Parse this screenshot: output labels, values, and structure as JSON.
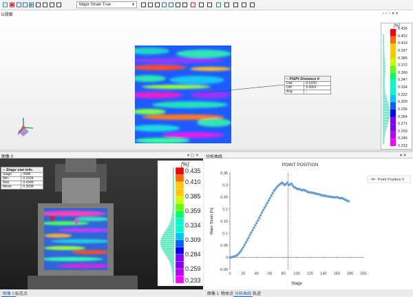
{
  "toolbar": {
    "dropdown_value": "Major Strain True",
    "icons": [
      "record-icon",
      "stop-icon",
      "prev-frame-icon",
      "next-frame-icon",
      "play-icon",
      "save-icon",
      "export-icon",
      "grid-icon",
      "layout-icon",
      "undo-icon",
      "redo-icon",
      "rotate-icon",
      "pan-icon",
      "fit-icon",
      "zoom-icon",
      "shape-icon",
      "delete-icon",
      "measure-icon",
      "display-icon",
      "sync-icon",
      "view-icon",
      "point-icon",
      "scale-icon",
      "compare-icon"
    ]
  },
  "view3d": {
    "title": "D视图",
    "controls": "‹ ›  ♂  ▾ ✕",
    "colorbar": {
      "unit": "[%]",
      "ticks": [
        "0.435",
        "0.422",
        "0.410",
        "0.397",
        "0.385",
        "0.372",
        "0.360",
        "0.347",
        "0.334",
        "0.322",
        "0.309",
        "0.296",
        "0.284",
        "0.271",
        "0.259",
        "0.246",
        "0.233"
      ]
    },
    "p2p": {
      "title": "Pt2Pt Distance 0",
      "rows": [
        [
          "Dist.",
          "0.0330"
        ],
        [
          "Def.",
          "0.0001"
        ],
        [
          "Avg.",
          "-"
        ]
      ]
    }
  },
  "camera": {
    "title": "图像 0",
    "header_controls": "▾ ▢ ✕",
    "stat": {
      "title": "Stage stat info.",
      "rows": [
        [
          "Stage",
          "0086"
        ],
        [
          "Min.",
          "0.2334"
        ],
        [
          "Max.",
          "0.4349"
        ],
        [
          "Mean.",
          "0.3038"
        ]
      ]
    },
    "colorbar": {
      "unit": "[%]",
      "ticks": [
        "0.435",
        "0.410",
        "0.385",
        "0.359",
        "0.334",
        "0.309",
        "0.284",
        "0.259",
        "0.233"
      ]
    }
  },
  "chart_pane": {
    "title": "分析曲线",
    "header_controls": "▾ ✕"
  },
  "chart_data": {
    "type": "line",
    "title": "POINT POSITION",
    "xlabel": "Stage",
    "ylabel": "Major Strain [%]",
    "xlim": [
      0,
      200
    ],
    "ylim": [
      -0.05,
      0.35
    ],
    "xticks": [
      "0",
      "20",
      "40",
      "60",
      "80",
      "100",
      "120",
      "140",
      "160",
      "180",
      "200"
    ],
    "yticks": [
      "-0.05",
      "0",
      "0.05",
      "0.1",
      "0.15",
      "0.2",
      "0.25",
      "0.3",
      "0.35"
    ],
    "marker_x": 87,
    "legend": "right",
    "series": [
      {
        "name": "Point Position 0",
        "x": [
          0,
          2,
          4,
          6,
          8,
          10,
          12,
          14,
          16,
          18,
          20,
          22,
          24,
          26,
          28,
          30,
          32,
          34,
          36,
          38,
          40,
          42,
          44,
          46,
          48,
          50,
          52,
          54,
          56,
          58,
          60,
          62,
          64,
          66,
          68,
          70,
          72,
          74,
          76,
          78,
          80,
          82,
          84,
          86,
          88,
          90,
          92,
          94,
          96,
          98,
          100,
          102,
          104,
          106,
          108,
          110,
          112,
          114,
          116,
          118,
          120,
          122,
          124,
          126,
          128,
          130,
          132,
          134,
          136,
          138,
          140,
          142,
          144,
          146,
          148,
          150,
          152,
          154,
          156,
          158,
          160,
          162,
          164,
          166,
          168,
          170,
          172,
          174,
          176,
          178
        ],
        "y": [
          0,
          0,
          0.002,
          0.003,
          0.005,
          0.008,
          0.012,
          0.018,
          0.025,
          0.033,
          0.042,
          0.052,
          0.062,
          0.072,
          0.082,
          0.093,
          0.103,
          0.113,
          0.123,
          0.133,
          0.143,
          0.153,
          0.164,
          0.175,
          0.186,
          0.196,
          0.206,
          0.216,
          0.226,
          0.236,
          0.246,
          0.256,
          0.266,
          0.276,
          0.283,
          0.29,
          0.296,
          0.301,
          0.305,
          0.31,
          0.305,
          0.3,
          0.304,
          0.31,
          0.3,
          0.302,
          0.306,
          0.298,
          0.29,
          0.29,
          0.285,
          0.283,
          0.284,
          0.28,
          0.278,
          0.28,
          0.278,
          0.276,
          0.272,
          0.27,
          0.27,
          0.268,
          0.268,
          0.266,
          0.265,
          0.263,
          0.262,
          0.262,
          0.258,
          0.258,
          0.255,
          0.257,
          0.254,
          0.253,
          0.252,
          0.252,
          0.25,
          0.25,
          0.249,
          0.249,
          0.25,
          0.248,
          0.246,
          0.245,
          0.246,
          0.243,
          0.24,
          0.238,
          0.234,
          0.233
        ]
      }
    ]
  },
  "tabs_left": [
    "图像 0",
    "标志点"
  ],
  "tabs_right": [
    "图像 1",
    "物体点",
    "分析曲线",
    "轨迹"
  ]
}
